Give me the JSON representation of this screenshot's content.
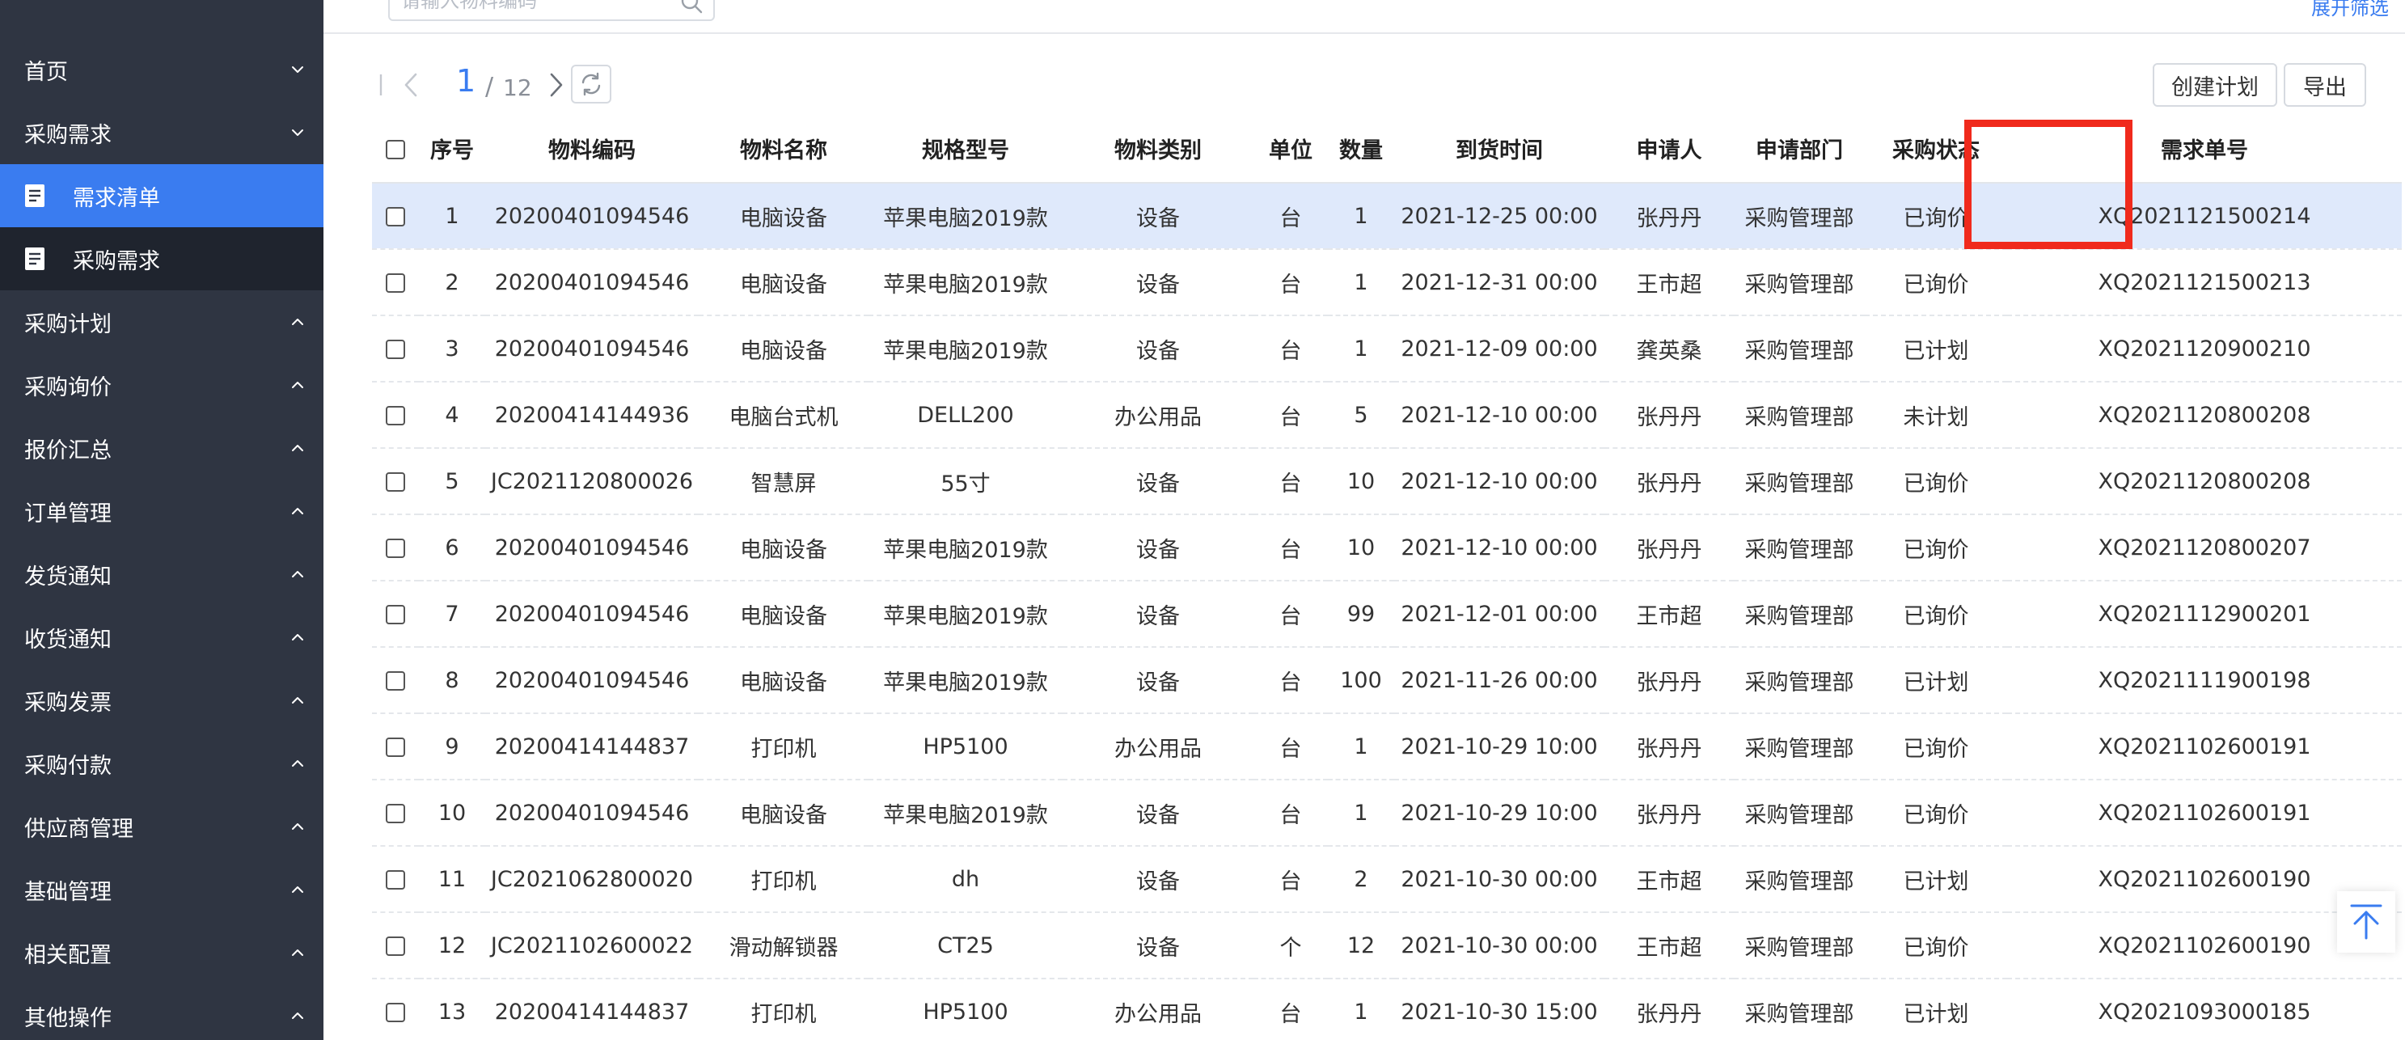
{
  "sidebar": {
    "items": [
      {
        "label": "首页",
        "type": "group",
        "chevron": "down"
      },
      {
        "label": "采购需求",
        "type": "group",
        "chevron": "down"
      },
      {
        "label": "需求清单",
        "type": "sub",
        "active": true,
        "icon": "document-icon"
      },
      {
        "label": "采购需求",
        "type": "sub",
        "active": false,
        "icon": "document-icon"
      },
      {
        "label": "采购计划",
        "type": "group",
        "chevron": "up"
      },
      {
        "label": "采购询价",
        "type": "group",
        "chevron": "up"
      },
      {
        "label": "报价汇总",
        "type": "group",
        "chevron": "up"
      },
      {
        "label": "订单管理",
        "type": "group",
        "chevron": "up"
      },
      {
        "label": "发货通知",
        "type": "group",
        "chevron": "up"
      },
      {
        "label": "收货通知",
        "type": "group",
        "chevron": "up"
      },
      {
        "label": "采购发票",
        "type": "group",
        "chevron": "up"
      },
      {
        "label": "采购付款",
        "type": "group",
        "chevron": "up"
      },
      {
        "label": "供应商管理",
        "type": "group",
        "chevron": "up"
      },
      {
        "label": "基础管理",
        "type": "group",
        "chevron": "up"
      },
      {
        "label": "相关配置",
        "type": "group",
        "chevron": "up"
      },
      {
        "label": "其他操作",
        "type": "group",
        "chevron": "up"
      }
    ]
  },
  "filter": {
    "search_placeholder": "请输入物料编码",
    "expand_label": "展开筛选"
  },
  "pager": {
    "current": "1",
    "separator": "/",
    "total": "12",
    "create_plan_label": "创建计划",
    "export_label": "导出"
  },
  "table": {
    "columns": [
      "序号",
      "物料编码",
      "物料名称",
      "规格型号",
      "物料类别",
      "单位",
      "数量",
      "到货时间",
      "申请人",
      "申请部门",
      "采购状态",
      "需求单号"
    ],
    "rows": [
      {
        "no": "1",
        "code": "20200401094546",
        "name": "电脑设备",
        "spec": "苹果电脑2019款",
        "category": "设备",
        "unit": "台",
        "qty": "1",
        "arrival": "2021-12-25 00:00",
        "applicant": "张丹丹",
        "dept": "采购管理部",
        "status": "已询价",
        "order": "XQ2021121500214"
      },
      {
        "no": "2",
        "code": "20200401094546",
        "name": "电脑设备",
        "spec": "苹果电脑2019款",
        "category": "设备",
        "unit": "台",
        "qty": "1",
        "arrival": "2021-12-31 00:00",
        "applicant": "王市超",
        "dept": "采购管理部",
        "status": "已询价",
        "order": "XQ2021121500213"
      },
      {
        "no": "3",
        "code": "20200401094546",
        "name": "电脑设备",
        "spec": "苹果电脑2019款",
        "category": "设备",
        "unit": "台",
        "qty": "1",
        "arrival": "2021-12-09 00:00",
        "applicant": "龚英桑",
        "dept": "采购管理部",
        "status": "已计划",
        "order": "XQ2021120900210"
      },
      {
        "no": "4",
        "code": "20200414144936",
        "name": "电脑台式机",
        "spec": "DELL200",
        "category": "办公用品",
        "unit": "台",
        "qty": "5",
        "arrival": "2021-12-10 00:00",
        "applicant": "张丹丹",
        "dept": "采购管理部",
        "status": "未计划",
        "order": "XQ2021120800208"
      },
      {
        "no": "5",
        "code": "JC2021120800026",
        "name": "智慧屏",
        "spec": "55寸",
        "category": "设备",
        "unit": "台",
        "qty": "10",
        "arrival": "2021-12-10 00:00",
        "applicant": "张丹丹",
        "dept": "采购管理部",
        "status": "已询价",
        "order": "XQ2021120800208"
      },
      {
        "no": "6",
        "code": "20200401094546",
        "name": "电脑设备",
        "spec": "苹果电脑2019款",
        "category": "设备",
        "unit": "台",
        "qty": "10",
        "arrival": "2021-12-10 00:00",
        "applicant": "张丹丹",
        "dept": "采购管理部",
        "status": "已询价",
        "order": "XQ2021120800207"
      },
      {
        "no": "7",
        "code": "20200401094546",
        "name": "电脑设备",
        "spec": "苹果电脑2019款",
        "category": "设备",
        "unit": "台",
        "qty": "99",
        "arrival": "2021-12-01 00:00",
        "applicant": "王市超",
        "dept": "采购管理部",
        "status": "已询价",
        "order": "XQ2021112900201"
      },
      {
        "no": "8",
        "code": "20200401094546",
        "name": "电脑设备",
        "spec": "苹果电脑2019款",
        "category": "设备",
        "unit": "台",
        "qty": "100",
        "arrival": "2021-11-26 00:00",
        "applicant": "张丹丹",
        "dept": "采购管理部",
        "status": "已计划",
        "order": "XQ2021111900198"
      },
      {
        "no": "9",
        "code": "20200414144837",
        "name": "打印机",
        "spec": "HP5100",
        "category": "办公用品",
        "unit": "台",
        "qty": "1",
        "arrival": "2021-10-29 10:00",
        "applicant": "张丹丹",
        "dept": "采购管理部",
        "status": "已询价",
        "order": "XQ2021102600191"
      },
      {
        "no": "10",
        "code": "20200401094546",
        "name": "电脑设备",
        "spec": "苹果电脑2019款",
        "category": "设备",
        "unit": "台",
        "qty": "1",
        "arrival": "2021-10-29 10:00",
        "applicant": "张丹丹",
        "dept": "采购管理部",
        "status": "已询价",
        "order": "XQ2021102600191"
      },
      {
        "no": "11",
        "code": "JC2021062800020",
        "name": "打印机",
        "spec": "dh",
        "category": "设备",
        "unit": "台",
        "qty": "2",
        "arrival": "2021-10-30 00:00",
        "applicant": "王市超",
        "dept": "采购管理部",
        "status": "已计划",
        "order": "XQ2021102600190"
      },
      {
        "no": "12",
        "code": "JC2021102600022",
        "name": "滑动解锁器",
        "spec": "CT25",
        "category": "设备",
        "unit": "个",
        "qty": "12",
        "arrival": "2021-10-30 00:00",
        "applicant": "王市超",
        "dept": "采购管理部",
        "status": "已询价",
        "order": "XQ2021102600190"
      },
      {
        "no": "13",
        "code": "20200414144837",
        "name": "打印机",
        "spec": "HP5100",
        "category": "办公用品",
        "unit": "台",
        "qty": "1",
        "arrival": "2021-10-30 15:00",
        "applicant": "张丹丹",
        "dept": "采购管理部",
        "status": "已计划",
        "order": "XQ2021093000185"
      }
    ]
  },
  "colors": {
    "sidebar_bg": "#2f3542",
    "sidebar_sub_bg": "#1f242e",
    "active_item_bg": "#3a7cf0",
    "accent": "#3a7cf0",
    "selected_row_bg": "#dfe9fb",
    "highlight_box": "#f02a1c"
  }
}
